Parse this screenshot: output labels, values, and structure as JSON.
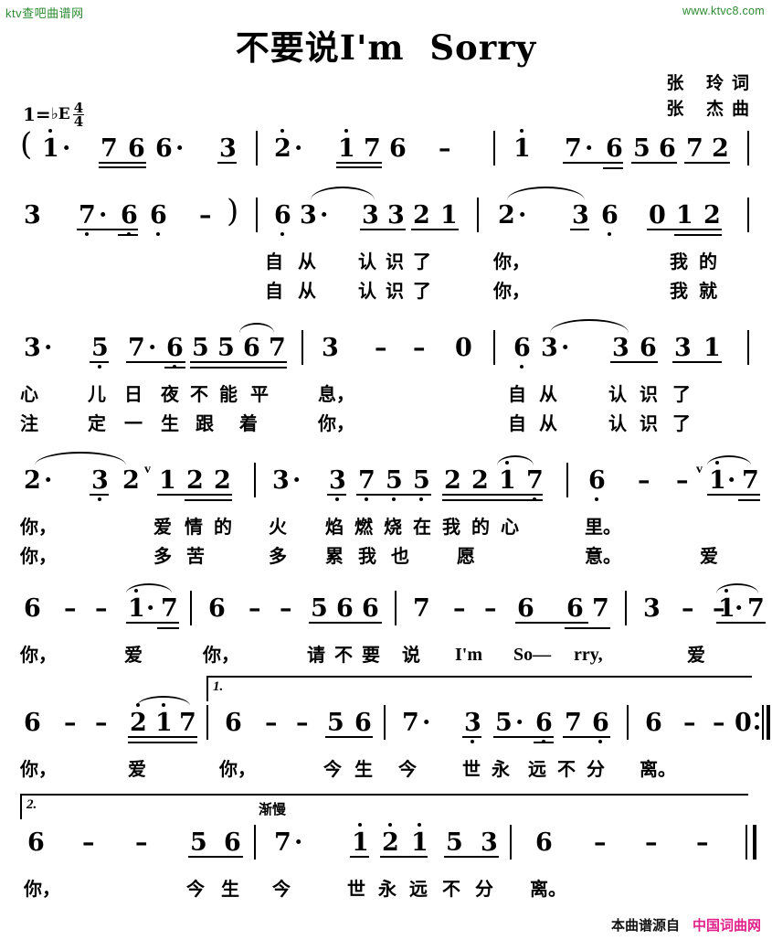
{
  "header": {
    "logo": "ktv查吧曲谱网",
    "url": "www.ktvc8.com",
    "title": "不要说I'm  Sorry",
    "lyricist": "张  玲词",
    "composer": "张  杰曲"
  },
  "key": {
    "prefix": "1=",
    "accidental": "♭",
    "letter": "E",
    "meter_num": "4",
    "meter_den": "4"
  },
  "markings": {
    "volta1": "1.",
    "volta2": "2.",
    "rit": "渐慢",
    "open_paren": "(",
    "close_paren": ")"
  },
  "notes": {
    "l1": [
      "1",
      "7",
      "6",
      "6",
      "3",
      "2",
      "1",
      "7",
      "6",
      "–",
      "1",
      "7",
      "6",
      "5",
      "6",
      "7",
      "2"
    ],
    "l2": [
      "3",
      "7",
      "6",
      "6",
      "–",
      "6",
      "3",
      "3",
      "3",
      "2",
      "1",
      "2",
      "3",
      "6",
      "0",
      "1",
      "2"
    ],
    "l3": [
      "3",
      "5",
      "7",
      "6",
      "5",
      "5",
      "6",
      "7",
      "3",
      "–",
      "–",
      "0",
      "6",
      "3",
      "3",
      "6",
      "3",
      "1"
    ],
    "l4": [
      "2",
      "3",
      "2",
      "1",
      "2",
      "2",
      "3",
      "3",
      "7",
      "5",
      "5",
      "2",
      "2",
      "1",
      "7",
      "6",
      "–",
      "–",
      "1",
      "7"
    ],
    "l5": [
      "6",
      "–",
      "–",
      "1",
      "7",
      "6",
      "–",
      "–",
      "5",
      "6",
      "6",
      "7",
      "–",
      "–",
      "6",
      "6",
      "7",
      "3",
      "–",
      "–",
      "1",
      "7"
    ],
    "l6": [
      "6",
      "–",
      "–",
      "2",
      "1",
      "7",
      "6",
      "–",
      "–",
      "5",
      "6",
      "7",
      "3",
      "5",
      "6",
      "7",
      "6",
      "6",
      "–",
      "–",
      "0"
    ],
    "l7": [
      "6",
      "–",
      "–",
      "5",
      "6",
      "7",
      "1",
      "2",
      "1",
      "5",
      "3",
      "6",
      "–",
      "–",
      "–"
    ]
  },
  "lyrics": {
    "verse1": {
      "l2": [
        "自",
        "从",
        "认",
        "识",
        "了",
        "你，",
        "我",
        "的"
      ],
      "l3": [
        "心",
        "儿",
        "日",
        "夜",
        "不",
        "能",
        "平",
        "息，",
        "自",
        "从",
        "认",
        "识",
        "了"
      ],
      "l4": [
        "你，",
        "爱",
        "情",
        "的",
        "火",
        "焰",
        "燃",
        "烧",
        "在",
        "我",
        "的",
        "心",
        "里。"
      ],
      "l5": [
        "你，",
        "爱",
        "你，",
        "请",
        "不",
        "要",
        "说",
        "I'm",
        "So—",
        "rry,",
        "爱"
      ],
      "l6": [
        "你，",
        "爱",
        "你，",
        "今",
        "生",
        "今",
        "世",
        "永",
        "远",
        "不",
        "分",
        "离。"
      ],
      "l7": [
        "你，",
        "今",
        "生",
        "今",
        "世",
        "永",
        "远",
        "不",
        "分",
        "离。"
      ]
    },
    "verse2": {
      "l2": [
        "自",
        "从",
        "认",
        "识",
        "了",
        "你，",
        "我",
        "就"
      ],
      "l3": [
        "注",
        "定",
        "一",
        "生",
        "跟",
        "着",
        "你，",
        "自",
        "从",
        "认",
        "识",
        "了"
      ],
      "l4": [
        "你，",
        "多",
        "苦",
        "多",
        "累",
        "我",
        "也",
        "愿",
        "意。",
        "爱"
      ]
    }
  },
  "footer": {
    "source_label": "本曲谱源自",
    "site_name": "中国词曲网"
  }
}
